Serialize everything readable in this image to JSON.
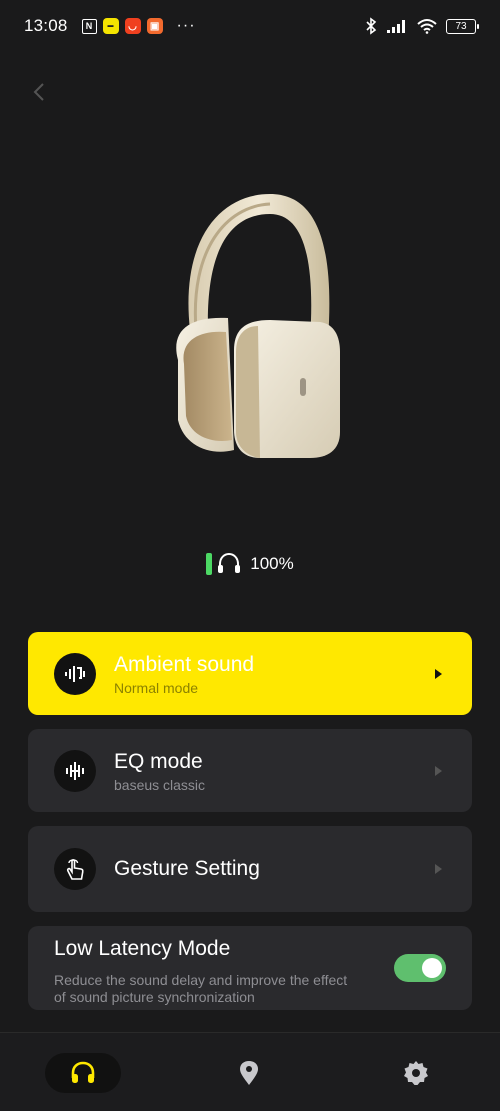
{
  "status_bar": {
    "time": "13:08",
    "battery": "73",
    "icons": [
      "nfc-icon",
      "baseus-app-icon",
      "aliexpress-icon",
      "shopping-app-icon",
      "more-icon",
      "bluetooth-icon",
      "signal-icon",
      "wifi-icon",
      "battery-icon"
    ]
  },
  "device": {
    "battery_percent_label": "100%",
    "battery_level": 1.0
  },
  "menu": {
    "ambient": {
      "title": "Ambient sound",
      "subtitle": "Normal mode",
      "icon": "ambient-sound-icon"
    },
    "eq": {
      "title": "EQ mode",
      "subtitle": "baseus classic",
      "icon": "equalizer-icon"
    },
    "gesture": {
      "title": "Gesture Setting",
      "icon": "gesture-icon"
    }
  },
  "low_latency": {
    "title": "Low Latency Mode",
    "description": "Reduce the sound delay and improve the effect of sound picture synchronization",
    "enabled": true
  },
  "nav": {
    "items": [
      "headphones-icon",
      "location-icon",
      "settings-icon"
    ],
    "active": "headphones-icon"
  },
  "colors": {
    "accent": "#ffe800",
    "background": "#1a1a1b",
    "card": "#2a2a2d",
    "toggle_on": "#5fbf6e",
    "battery_green": "#4cd964"
  }
}
